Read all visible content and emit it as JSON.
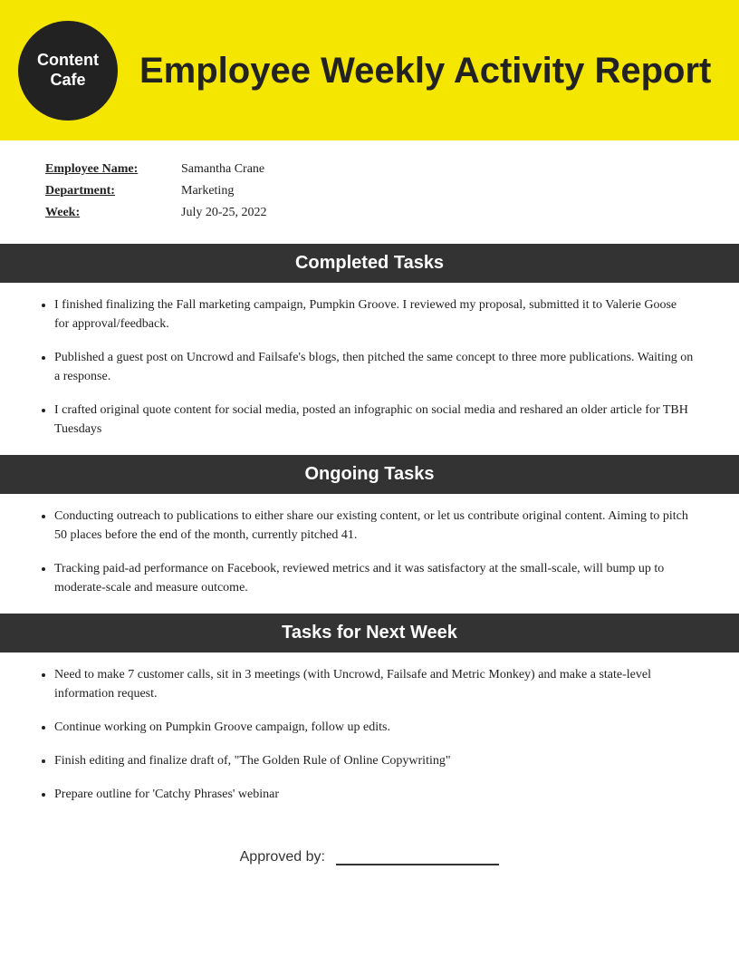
{
  "header": {
    "logo_line1": "Content",
    "logo_line2": "Cafe",
    "title": "Employee Weekly Activity Report"
  },
  "info": {
    "employee_name_label": "Employee Name:",
    "employee_name_value": "Samantha Crane",
    "department_label": "Department:",
    "department_value": "Marketing",
    "week_label": "Week:",
    "week_value": "July 20-25, 2022"
  },
  "completed_tasks": {
    "heading": "Completed Tasks",
    "items": [
      "I finished finalizing the Fall marketing campaign, Pumpkin Groove. I reviewed my proposal, submitted it to Valerie Goose for approval/feedback.",
      "Published a guest post on Uncrowd and Failsafe's blogs, then pitched the same concept to three more publications. Waiting on a response.",
      "I crafted original quote content for social media, posted an infographic on social media and reshared an older article for TBH Tuesdays"
    ]
  },
  "ongoing_tasks": {
    "heading": "Ongoing Tasks",
    "items": [
      "Conducting outreach to publications to either share our existing content, or let us contribute original content. Aiming to pitch 50 places before the end of the month, currently pitched 41.",
      "Tracking paid-ad performance on Facebook, reviewed metrics and it was satisfactory at the small-scale, will bump up to moderate-scale and measure outcome."
    ]
  },
  "next_week_tasks": {
    "heading": "Tasks for Next Week",
    "items": [
      "Need to make 7 customer calls, sit in 3 meetings (with Uncrowd, Failsafe and Metric Monkey) and make a state-level information request.",
      "Continue working on Pumpkin Groove campaign, follow up edits.",
      "Finish editing and finalize draft of, \"The Golden Rule of Online Copywriting\"",
      "Prepare outline for 'Catchy Phrases' webinar"
    ]
  },
  "approved": {
    "label": "Approved by:"
  }
}
